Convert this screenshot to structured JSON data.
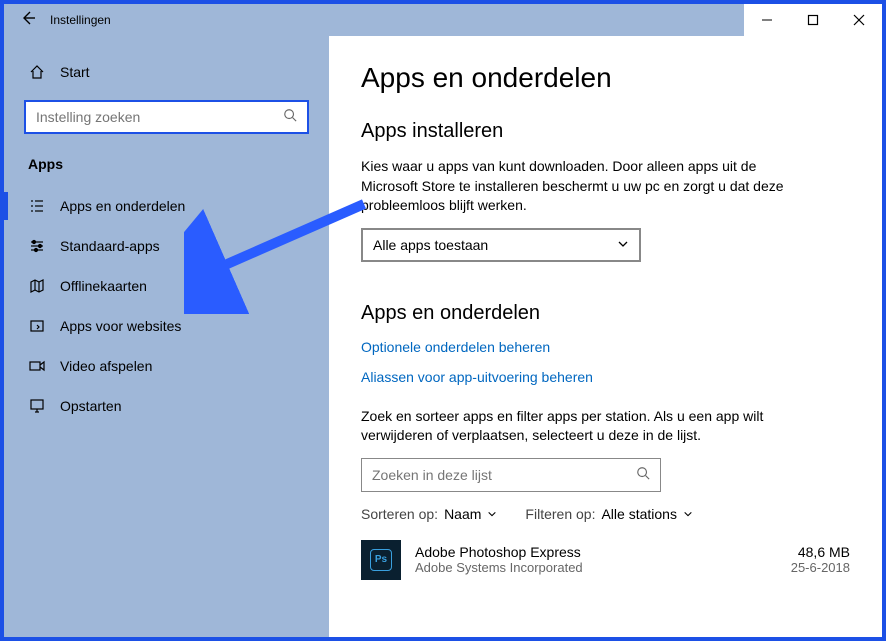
{
  "window": {
    "title": "Instellingen"
  },
  "sidebar": {
    "home": "Start",
    "search_placeholder": "Instelling zoeken",
    "section": "Apps",
    "items": [
      {
        "label": "Apps en onderdelen"
      },
      {
        "label": "Standaard-apps"
      },
      {
        "label": "Offlinekaarten"
      },
      {
        "label": "Apps voor websites"
      },
      {
        "label": "Video afspelen"
      },
      {
        "label": "Opstarten"
      }
    ]
  },
  "main": {
    "title": "Apps en onderdelen",
    "install": {
      "heading": "Apps installeren",
      "body": "Kies waar u apps van kunt downloaden. Door alleen apps uit de Microsoft Store te installeren beschermt u uw pc en zorgt u dat deze probleemloos blijft werken.",
      "dropdown_value": "Alle apps toestaan"
    },
    "features": {
      "heading": "Apps en onderdelen",
      "link_optional": "Optionele onderdelen beheren",
      "link_aliases": "Aliassen voor app-uitvoering beheren",
      "body": "Zoek en sorteer apps en filter apps per station. Als u een app wilt verwijderen of verplaatsen, selecteert u deze in de lijst.",
      "list_search_placeholder": "Zoeken in deze lijst",
      "sort_label": "Sorteren op:",
      "sort_value": "Naam",
      "filter_label": "Filteren op:",
      "filter_value": "Alle stations"
    },
    "apps": [
      {
        "name": "Adobe Photoshop Express",
        "publisher": "Adobe Systems Incorporated",
        "size": "48,6 MB",
        "date": "25-6-2018",
        "icon_text": "Ps"
      }
    ]
  }
}
